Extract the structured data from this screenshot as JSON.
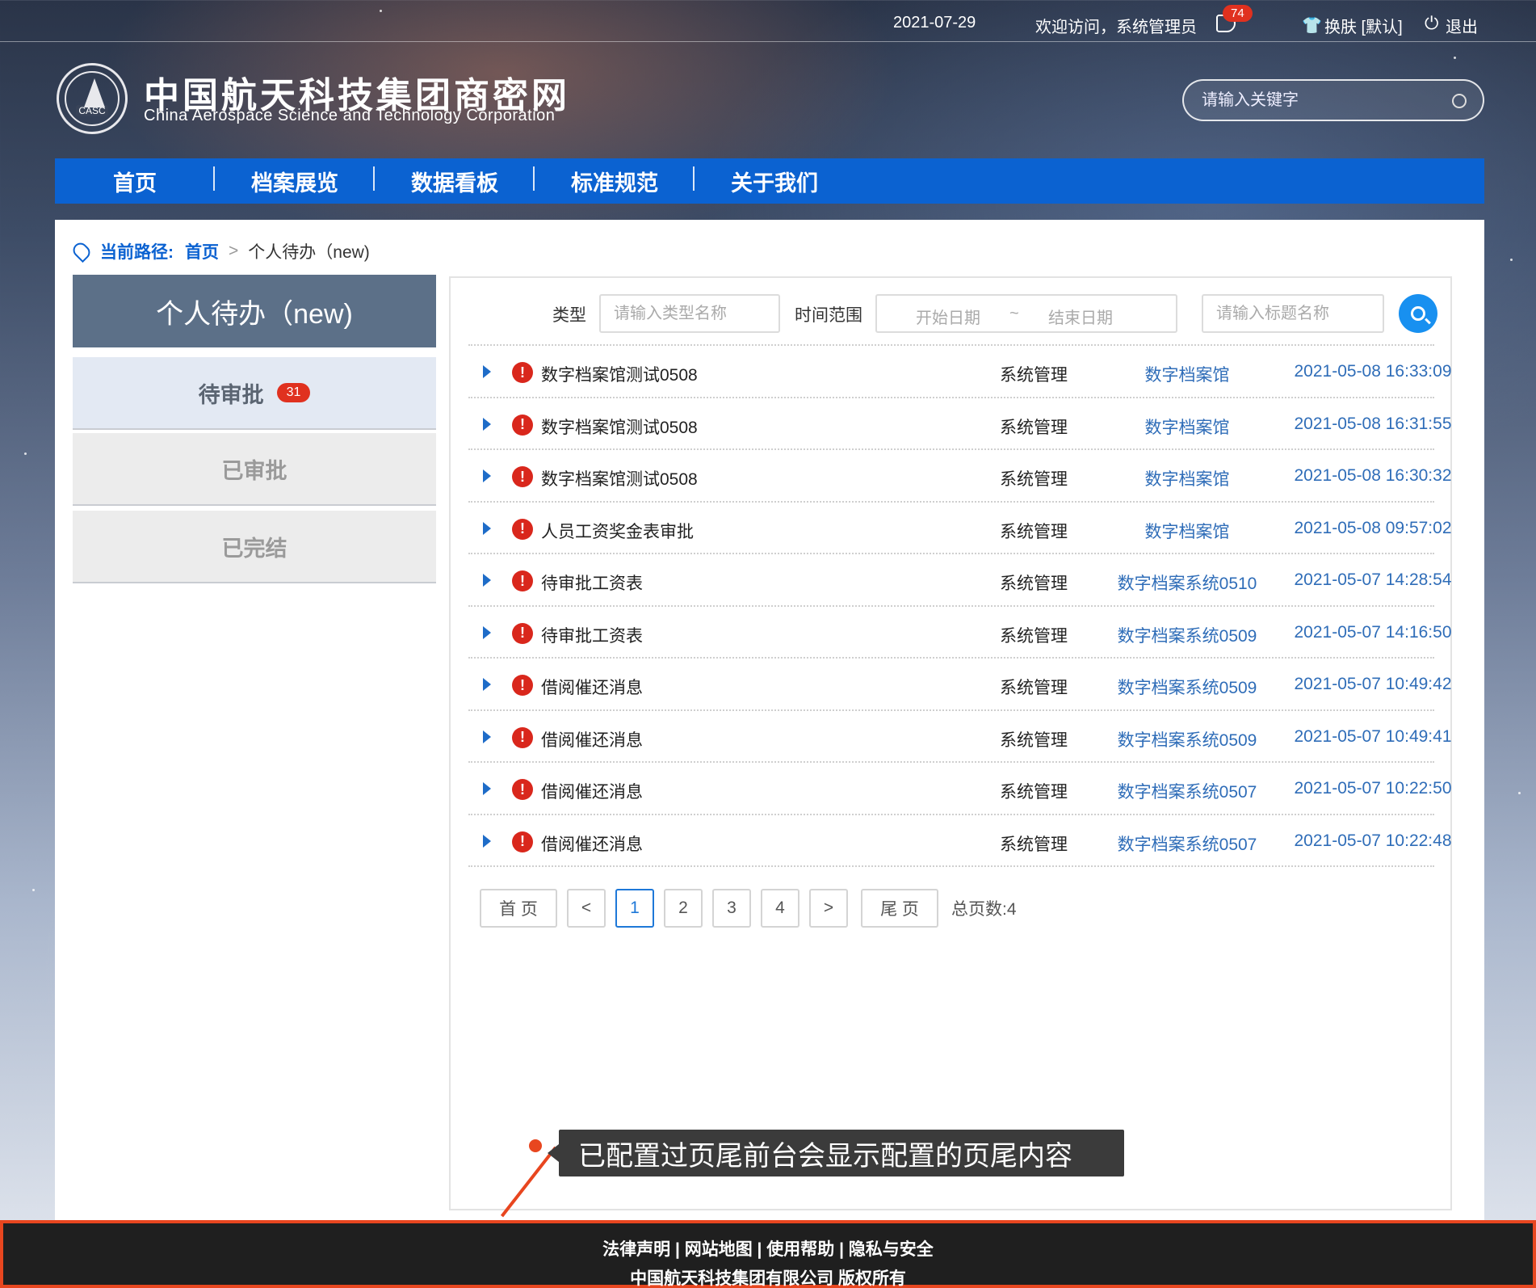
{
  "topbar": {
    "date": "2021-07-29",
    "welcome": "欢迎访问，系统管理员",
    "message_count": "74",
    "skin": "换肤 [默认]",
    "logout": "退出"
  },
  "header": {
    "title": "中国航天科技集团商密网",
    "subtitle": "China Aerospace Science and Technology Corporation",
    "logo_text": "CASC",
    "search_placeholder": "请输入关键字"
  },
  "nav": {
    "items": [
      "首页",
      "档案展览",
      "数据看板",
      "标准规范",
      "关于我们"
    ]
  },
  "breadcrumb": {
    "label": "当前路径:",
    "home": "首页",
    "current": "个人待办（new)"
  },
  "sidebar": {
    "title": "个人待办（new)",
    "items": [
      {
        "label": "待审批",
        "badge": "31"
      },
      {
        "label": "已审批"
      },
      {
        "label": "已完结"
      }
    ]
  },
  "filters": {
    "type_label": "类型",
    "type_placeholder": "请输入类型名称",
    "time_label": "时间范围",
    "start_placeholder": "开始日期",
    "range_sep": "~",
    "end_placeholder": "结束日期",
    "title_placeholder": "请输入标题名称"
  },
  "rows": [
    {
      "title": "数字档案馆测试0508",
      "category": "系统管理",
      "system": "数字档案馆",
      "time": "2021-05-08 16:33:09"
    },
    {
      "title": "数字档案馆测试0508",
      "category": "系统管理",
      "system": "数字档案馆",
      "time": "2021-05-08 16:31:55"
    },
    {
      "title": "数字档案馆测试0508",
      "category": "系统管理",
      "system": "数字档案馆",
      "time": "2021-05-08 16:30:32"
    },
    {
      "title": "人员工资奖金表审批",
      "category": "系统管理",
      "system": "数字档案馆",
      "time": "2021-05-08 09:57:02"
    },
    {
      "title": "待审批工资表",
      "category": "系统管理",
      "system": "数字档案系统0510",
      "time": "2021-05-07 14:28:54"
    },
    {
      "title": "待审批工资表",
      "category": "系统管理",
      "system": "数字档案系统0509",
      "time": "2021-05-07 14:16:50"
    },
    {
      "title": "借阅催还消息",
      "category": "系统管理",
      "system": "数字档案系统0509",
      "time": "2021-05-07 10:49:42"
    },
    {
      "title": "借阅催还消息",
      "category": "系统管理",
      "system": "数字档案系统0509",
      "time": "2021-05-07 10:49:41"
    },
    {
      "title": "借阅催还消息",
      "category": "系统管理",
      "system": "数字档案系统0507",
      "time": "2021-05-07 10:22:50"
    },
    {
      "title": "借阅催还消息",
      "category": "系统管理",
      "system": "数字档案系统0507",
      "time": "2021-05-07 10:22:48"
    }
  ],
  "pager": {
    "first": "首 页",
    "prev": "<",
    "pages": [
      "1",
      "2",
      "3",
      "4"
    ],
    "current": "1",
    "next": ">",
    "last": "尾 页",
    "total": "总页数:4"
  },
  "annotation": {
    "text": "已配置过页尾前台会显示配置的页尾内容"
  },
  "footer": {
    "links": "法律声明 | 网站地图 | 使用帮助 | 隐私与安全",
    "copyright": "中国航天科技集团有限公司   版权所有"
  },
  "colors": {
    "nav_blue": "#0b62d1",
    "link_blue": "#2f6db8",
    "badge_red": "#e0311f",
    "annotation_orange": "#e8461f"
  }
}
